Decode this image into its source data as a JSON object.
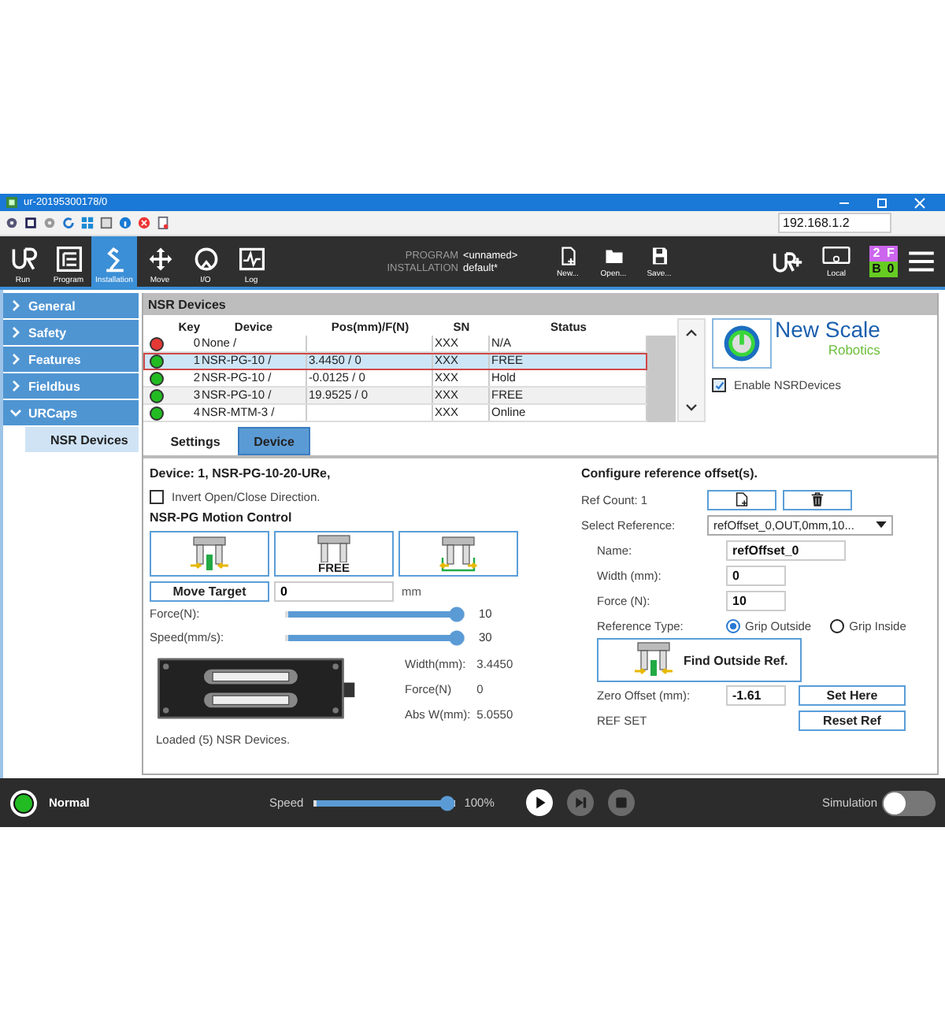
{
  "window": {
    "title": "ur-20195300178/0"
  },
  "toolbar": {
    "address": "192.168.1.2"
  },
  "nav": [
    {
      "label": "Run",
      "kind": "run",
      "selected": false
    },
    {
      "label": "Program",
      "kind": "program",
      "selected": false
    },
    {
      "label": "Installation",
      "kind": "installation",
      "selected": true
    },
    {
      "label": "Move",
      "kind": "move",
      "selected": false
    },
    {
      "label": "I/O",
      "kind": "io",
      "selected": false
    },
    {
      "label": "Log",
      "kind": "log",
      "selected": false
    }
  ],
  "program_info": [
    {
      "label": "PROGRAM",
      "value": "<unnamed>"
    },
    {
      "label": "INSTALLATION",
      "value": "default*"
    }
  ],
  "file_buttons": [
    {
      "label": "New...",
      "kind": "new"
    },
    {
      "label": "Open...",
      "kind": "open"
    },
    {
      "label": "Save...",
      "kind": "save"
    }
  ],
  "local": {
    "label": "Local"
  },
  "status_grid": [
    {
      "text": "2",
      "color": "#cc66ee"
    },
    {
      "text": "F",
      "color": "#cc66ee"
    },
    {
      "text": "B",
      "color": "#66cc22"
    },
    {
      "text": "0",
      "color": "#66cc22"
    }
  ],
  "sidebar": [
    {
      "label": "General",
      "expanded": false
    },
    {
      "label": "Safety",
      "expanded": false
    },
    {
      "label": "Features",
      "expanded": false
    },
    {
      "label": "Fieldbus",
      "expanded": false
    },
    {
      "label": "URCaps",
      "expanded": true,
      "children": [
        {
          "label": "NSR Devices",
          "selected": true
        }
      ]
    }
  ],
  "panel": {
    "title": "NSR Devices"
  },
  "table": {
    "columns": [
      "Key",
      "Device",
      "Pos(mm)/F(N)",
      "SN",
      "Status"
    ],
    "rows": [
      {
        "color": "#e53935",
        "key": "0",
        "device": "None /",
        "sn": "XXX",
        "status": "N/A",
        "selected": false
      },
      {
        "color": "#22bb22",
        "key": "1",
        "device": "NSR-PG-10 /",
        "pos": "3.4450 / 0",
        "sn": "XXX",
        "status": "FREE",
        "selected": true
      },
      {
        "color": "#22bb22",
        "key": "2",
        "device": "NSR-PG-10 /",
        "pos": "-0.0125 / 0",
        "sn": "XXX",
        "status": "Hold",
        "selected": false
      },
      {
        "color": "#22bb22",
        "key": "3",
        "device": "NSR-PG-10 /",
        "pos": "19.9525 / 0",
        "sn": "XXX",
        "status": "FREE",
        "selected": false
      },
      {
        "color": "#22bb22",
        "key": "4",
        "device": "NSR-MTM-3 /",
        "sn": "XXX",
        "status": "Online",
        "selected": false
      }
    ]
  },
  "logo": {
    "name": "New Scale",
    "tagline": "Robotics"
  },
  "enable": {
    "label": "Enable NSRDevices",
    "checked": true
  },
  "tabs": [
    {
      "label": "Settings",
      "selected": false
    },
    {
      "label": "Device",
      "selected": true
    }
  ],
  "device": {
    "title": "Device: 1, NSR-PG-10-20-URe,",
    "invert": {
      "label": "Invert Open/Close Direction.",
      "checked": false
    },
    "motion_title": "NSR-PG Motion Control",
    "motion_buttons": [
      {
        "kind": "close"
      },
      {
        "kind": "free",
        "label": "FREE"
      },
      {
        "kind": "open"
      }
    ],
    "move_target": {
      "label": "Move Target",
      "value": "0",
      "unit": "mm"
    },
    "sliders": [
      {
        "label": "Force(N):",
        "level": 1,
        "reading": "10"
      },
      {
        "label": "Speed(mm/s):",
        "level": 1,
        "reading": "30"
      }
    ],
    "readings": [
      {
        "label": "Width(mm):",
        "value": "3.4450"
      },
      {
        "label": "Force(N)",
        "value": "0"
      },
      {
        "label": "Abs W(mm):",
        "value": "5.0550"
      }
    ],
    "message": "Loaded (5) NSR Devices."
  },
  "reference": {
    "title": "Configure reference offset(s).",
    "ref_count": "Ref Count: 1",
    "select_label": "Select Reference:",
    "select_value": "refOffset_0,OUT,0mm,10...",
    "fields": [
      {
        "label": "Name:",
        "value": "refOffset_0"
      },
      {
        "label": "Width (mm):",
        "value": "0"
      },
      {
        "label": "Force (N):",
        "value": "10"
      }
    ],
    "type_label": "Reference Type:",
    "types": [
      {
        "label": "Grip Outside",
        "selected": true
      },
      {
        "label": "Grip Inside",
        "selected": false
      }
    ],
    "find_button": "Find Outside Ref.",
    "zero_label": "Zero Offset (mm):",
    "zero_value": "-1.61",
    "set_here": "Set Here",
    "ref_status": "REF SET",
    "reset": "Reset Ref"
  },
  "footer": {
    "mode": "Normal",
    "speed_label": "Speed",
    "speed": {
      "level": 1,
      "reading": "100%"
    },
    "simulation": {
      "label": "Simulation",
      "on": false
    }
  }
}
